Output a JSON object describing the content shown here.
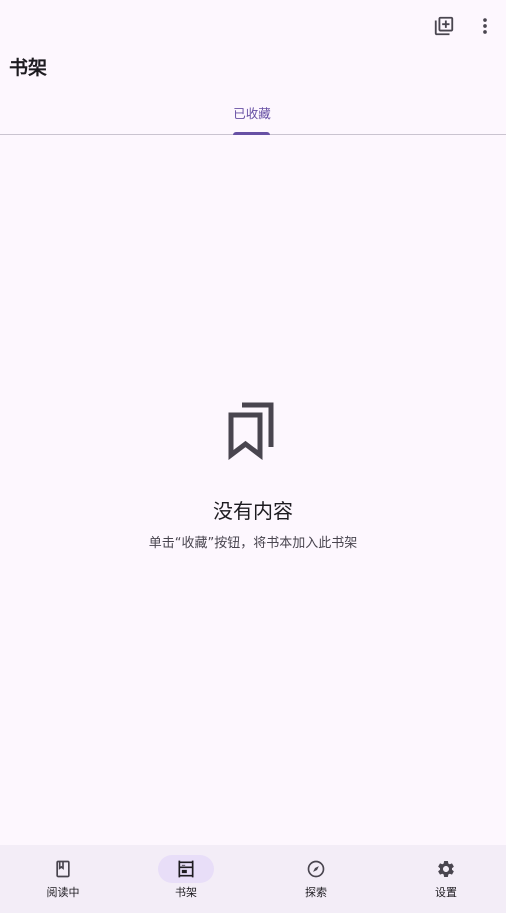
{
  "header": {
    "title": "书架",
    "actions": [
      {
        "icon": "add-to-library-icon"
      },
      {
        "icon": "more-vert-icon"
      }
    ]
  },
  "tabs": [
    {
      "label": "已收藏",
      "selected": true
    }
  ],
  "empty_state": {
    "icon": "bookmarks-icon",
    "title": "没有内容",
    "description": "单击“收藏”按钮，将书本加入此书架"
  },
  "bottom_nav": {
    "items": [
      {
        "label": "阅读中",
        "icon": "book-icon",
        "selected": false
      },
      {
        "label": "书架",
        "icon": "shelf-icon",
        "selected": true
      },
      {
        "label": "探索",
        "icon": "compass-icon",
        "selected": false
      },
      {
        "label": "设置",
        "icon": "settings-icon",
        "selected": false
      }
    ]
  },
  "colors": {
    "background": "#FDF7FE",
    "accent": "#6750A4",
    "nav_background": "#F3EDF7",
    "nav_active_pill": "#E8DEF8",
    "text_primary": "#1D1B20",
    "text_secondary": "#49454F"
  }
}
